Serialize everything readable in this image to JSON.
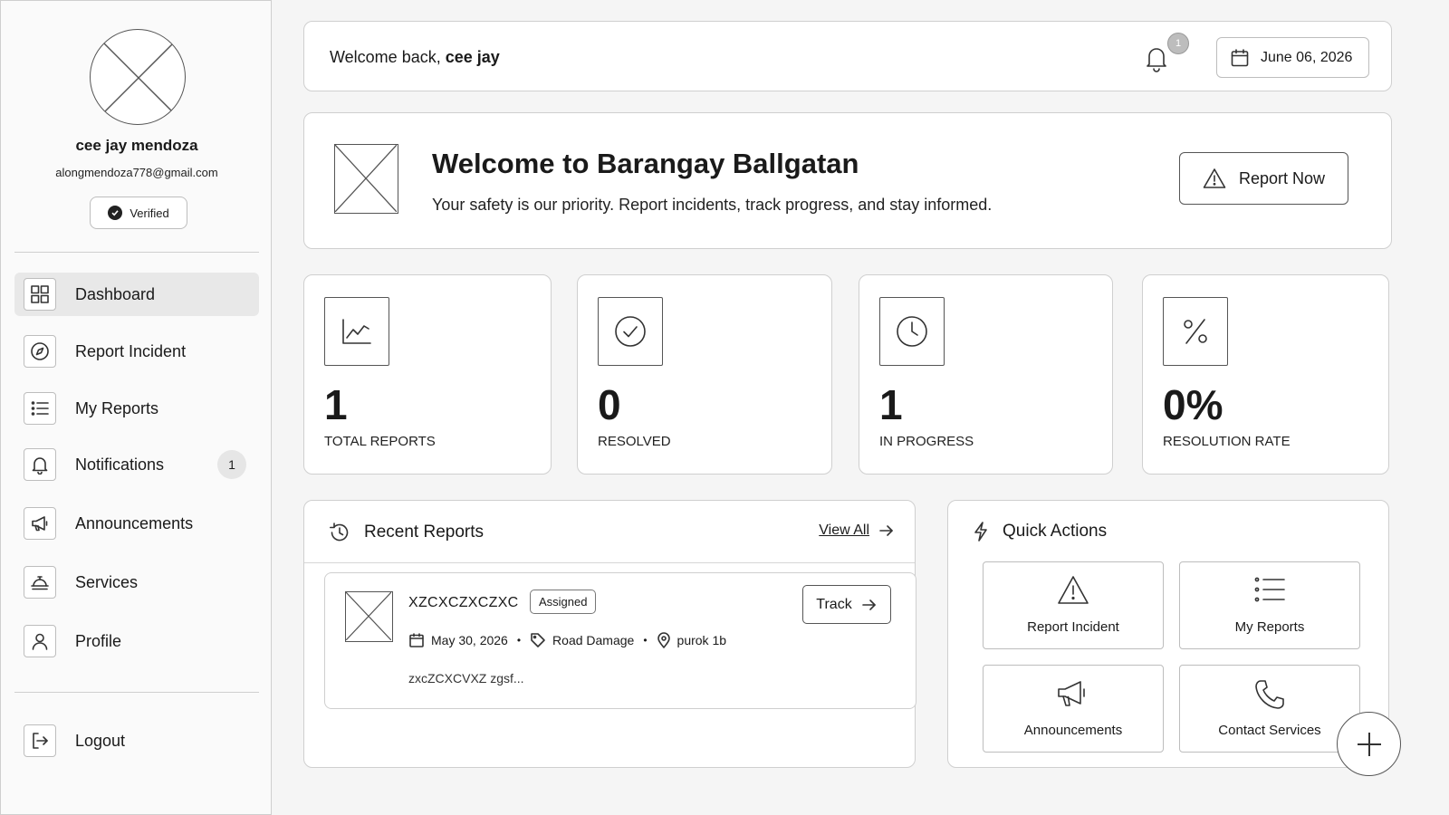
{
  "user": {
    "name": "cee jay mendoza",
    "email": "alongmendoza778@gmail.com",
    "verified_label": "Verified"
  },
  "sidebar": {
    "items": [
      {
        "label": "Dashboard",
        "icon": "grid-icon",
        "active": true
      },
      {
        "label": "Report Incident",
        "icon": "compass-icon"
      },
      {
        "label": "My Reports",
        "icon": "list-icon"
      },
      {
        "label": "Notifications",
        "icon": "bell-icon",
        "badge": "1"
      },
      {
        "label": "Announcements",
        "icon": "megaphone-icon"
      },
      {
        "label": "Services",
        "icon": "services-icon"
      },
      {
        "label": "Profile",
        "icon": "user-icon"
      }
    ],
    "logout_label": "Logout"
  },
  "header": {
    "welcome_prefix": "Welcome back, ",
    "welcome_name": "cee jay",
    "notification_count": "1",
    "date": "June 06, 2026"
  },
  "hero": {
    "title": "Welcome to Barangay Ballgatan",
    "subtitle": "Your safety is our priority. Report incidents, track progress, and stay informed.",
    "button_label": "Report Now"
  },
  "stats": [
    {
      "value": "1",
      "label": "TOTAL REPORTS",
      "icon": "chart-icon"
    },
    {
      "value": "0",
      "label": "RESOLVED",
      "icon": "check-circle-icon"
    },
    {
      "value": "1",
      "label": "IN PROGRESS",
      "icon": "clock-icon"
    },
    {
      "value": "0%",
      "label": "RESOLUTION RATE",
      "icon": "percent-icon"
    }
  ],
  "recent_reports": {
    "title": "Recent Reports",
    "view_all_label": "View All",
    "items": [
      {
        "id": "XZCXCZXCZXC",
        "status": "Assigned",
        "date": "May 30, 2026",
        "category": "Road Damage",
        "location": "purok 1b",
        "description": "zxcZCXCVXZ zgsf...",
        "track_label": "Track"
      }
    ]
  },
  "quick_actions": {
    "title": "Quick Actions",
    "items": [
      {
        "label": "Report Incident",
        "icon": "warning-icon"
      },
      {
        "label": "My Reports",
        "icon": "list-icon"
      },
      {
        "label": "Announcements",
        "icon": "megaphone-icon"
      },
      {
        "label": "Contact Services",
        "icon": "phone-icon"
      }
    ]
  },
  "colors": {
    "background": "#f5f5f5",
    "card": "#ffffff",
    "border": "#cfcfcf",
    "text": "#1a1a1a",
    "active_nav": "#e8e8e8"
  }
}
